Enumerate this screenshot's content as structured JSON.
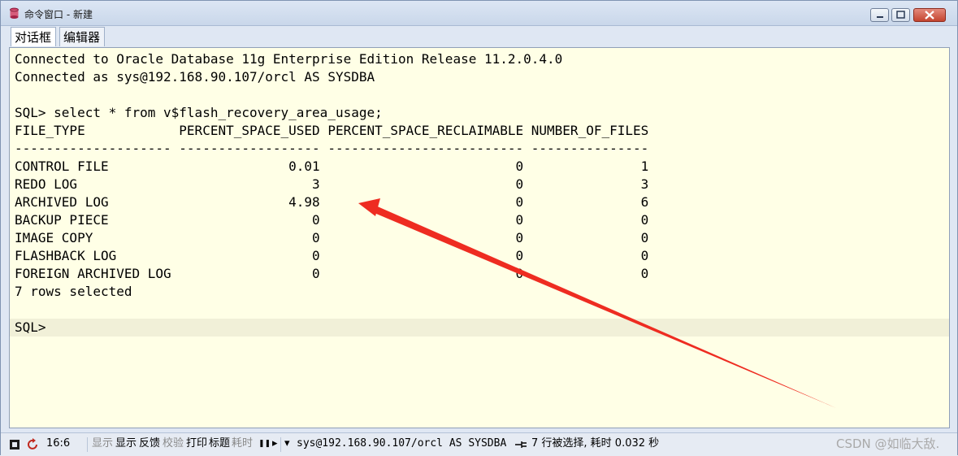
{
  "window": {
    "title": "命令窗口 - 新建"
  },
  "tabs": [
    {
      "label": "对话框"
    },
    {
      "label": "编辑器"
    }
  ],
  "console": {
    "lines": [
      "Connected to Oracle Database 11g Enterprise Edition Release 11.2.0.4.0",
      "Connected as sys@192.168.90.107/orcl AS SYSDBA",
      "",
      "SQL> select * from v$flash_recovery_area_usage;",
      "FILE_TYPE            PERCENT_SPACE_USED PERCENT_SPACE_RECLAIMABLE NUMBER_OF_FILES",
      "-------------------- ------------------ ------------------------- ---------------",
      "CONTROL FILE                       0.01                         0               1",
      "REDO LOG                              3                         0               3",
      "ARCHIVED LOG                       4.98                         0               6",
      "BACKUP PIECE                          0                         0               0",
      "IMAGE COPY                            0                         0               0",
      "FLASHBACK LOG                         0                         0               0",
      "FOREIGN ARCHIVED LOG                  0                         0               0",
      "7 rows selected",
      "",
      "SQL> "
    ]
  },
  "statusbar": {
    "position": "16:6",
    "display_dim": "显示",
    "display": "显示",
    "feedback": "反馈",
    "verify": "校验",
    "print": "打印",
    "headings": "标题",
    "timing": "耗时",
    "pause_glyph": "❚❚",
    "play_glyph": "▸",
    "dropdown_glyph": "▾",
    "connection": "sys@192.168.90.107/orcl AS SYSDBA",
    "message": "7 行被选择, 耗时 0.032 秒",
    "watermark": "CSDN @如临大敌."
  },
  "colors": {
    "arrow": "#ee2c21",
    "console_bg": "#ffffe6"
  }
}
